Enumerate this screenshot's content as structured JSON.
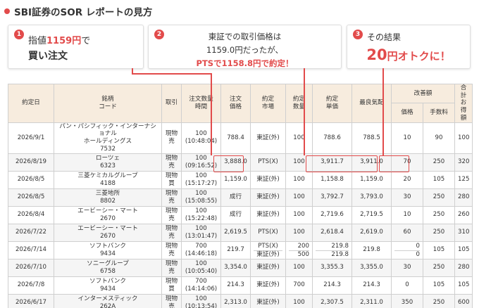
{
  "title": "SBI証券のSOR レポートの見方",
  "callouts": [
    {
      "num": "1",
      "pre": "指値",
      "red": "1159円",
      "post": "で",
      "line2": "買い注文"
    },
    {
      "num": "2",
      "line1": "東証での取引価格は",
      "line2": "1159.0円だったが、",
      "line3": "PTSで1158.8円で約定！"
    },
    {
      "num": "3",
      "line1": "その結果",
      "big": "20",
      "rest": "円オトクに！"
    }
  ],
  "table": {
    "headers": {
      "date": "約定日",
      "name": "銘柄\nコード",
      "type": "取引",
      "qty_time": "注文数量\n時間",
      "order_price": "注文\n価格",
      "market": "約定\n市場",
      "exec_qty": "約定\n数量",
      "exec_price": "約定\n単価",
      "best_quote": "最良気配",
      "improve": "改善額",
      "improve_price": "価格",
      "improve_fee": "手数料",
      "total": "合計\nお得額"
    },
    "rows": [
      {
        "date": "2026/9/1",
        "name": "パン・パシフィック・インターナショナル\nホールディングス",
        "code": "7532",
        "type": "現物\n売",
        "qty": "100",
        "time": "(10:48:04)",
        "order_price": "788.4",
        "markets": [
          "東証(外)"
        ],
        "exec_qtys": [
          "100"
        ],
        "exec_prices": [
          "788.6"
        ],
        "best": "788.5",
        "imp_prices": [
          "10"
        ],
        "fee": "90",
        "total": "100"
      },
      {
        "date": "2026/8/19",
        "name": "ローツェ",
        "code": "6323",
        "type": "現物\n売",
        "qty": "100",
        "time": "(09:16:52)",
        "order_price": "3,888.0",
        "markets": [
          "PTS(X)"
        ],
        "exec_qtys": [
          "100"
        ],
        "exec_prices": [
          "3,911.7"
        ],
        "best": "3,911.0",
        "imp_prices": [
          "70"
        ],
        "fee": "250",
        "total": "320"
      },
      {
        "date": "2026/8/5",
        "name": "三菱ケミカルグループ",
        "code": "4188",
        "type": "現物\n買",
        "qty": "100",
        "time": "(15:17:27)",
        "order_price": "1,159.0",
        "markets": [
          "東証(外)"
        ],
        "exec_qtys": [
          "100"
        ],
        "exec_prices": [
          "1,158.8"
        ],
        "best": "1,159.0",
        "imp_prices": [
          "20"
        ],
        "fee": "105",
        "total": "125"
      },
      {
        "date": "2026/8/5",
        "name": "三菱地所",
        "code": "8802",
        "type": "現物\n売",
        "qty": "100",
        "time": "(15:08:55)",
        "order_price": "成行",
        "markets": [
          "東証(外)"
        ],
        "exec_qtys": [
          "100"
        ],
        "exec_prices": [
          "3,792.7"
        ],
        "best": "3,793.0",
        "imp_prices": [
          "30"
        ],
        "fee": "250",
        "total": "280"
      },
      {
        "date": "2026/8/4",
        "name": "エービーシー・マート",
        "code": "2670",
        "type": "現物\n売",
        "qty": "100",
        "time": "(15:22:48)",
        "order_price": "成行",
        "markets": [
          "東証(外)"
        ],
        "exec_qtys": [
          "100"
        ],
        "exec_prices": [
          "2,719.6"
        ],
        "best": "2,719.5",
        "imp_prices": [
          "10"
        ],
        "fee": "250",
        "total": "260"
      },
      {
        "date": "2026/7/22",
        "name": "エービーシー・マート",
        "code": "2670",
        "type": "現物\n売",
        "qty": "100",
        "time": "(13:01:47)",
        "order_price": "2,619.5",
        "markets": [
          "PTS(X)"
        ],
        "exec_qtys": [
          "100"
        ],
        "exec_prices": [
          "2,618.4"
        ],
        "best": "2,619.0",
        "imp_prices": [
          "60"
        ],
        "fee": "250",
        "total": "310"
      },
      {
        "date": "2026/7/14",
        "name": "ソフトバンク",
        "code": "9434",
        "type": "現物\n売",
        "qty": "700",
        "time": "(14:46:18)",
        "order_price": "219.7",
        "markets": [
          "PTS(X)",
          "東証(外)"
        ],
        "exec_qtys": [
          "200",
          "500"
        ],
        "exec_prices": [
          "219.8",
          "219.8"
        ],
        "best": "219.8",
        "imp_prices": [
          "0",
          "0"
        ],
        "fee": "105",
        "total": "105"
      },
      {
        "date": "2026/7/10",
        "name": "ソニーグループ",
        "code": "6758",
        "type": "現物\n売",
        "qty": "100",
        "time": "(10:05:40)",
        "order_price": "3,354.0",
        "markets": [
          "東証(外)"
        ],
        "exec_qtys": [
          "100"
        ],
        "exec_prices": [
          "3,355.3"
        ],
        "best": "3,355.0",
        "imp_prices": [
          "30"
        ],
        "fee": "250",
        "total": "280"
      },
      {
        "date": "2026/7/8",
        "name": "ソフトバンク",
        "code": "9434",
        "type": "現物\n買",
        "qty": "700",
        "time": "(14:14:06)",
        "order_price": "214.3",
        "markets": [
          "東証(外)"
        ],
        "exec_qtys": [
          "700"
        ],
        "exec_prices": [
          "214.3"
        ],
        "best": "214.3",
        "imp_prices": [
          "0"
        ],
        "fee": "105",
        "total": "105"
      },
      {
        "date": "2026/6/17",
        "name": "インターメスティック",
        "code": "262A",
        "type": "現物\n売",
        "qty": "100",
        "time": "(10:13:54)",
        "order_price": "2,313.0",
        "markets": [
          "東証(外)"
        ],
        "exec_qtys": [
          "100"
        ],
        "exec_prices": [
          "2,307.5"
        ],
        "best": "2,311.0",
        "imp_prices": [
          "350"
        ],
        "fee": "250",
        "total": "600"
      }
    ]
  },
  "colors": {
    "accent": "#e24b4b",
    "header_bg": "#f7ecde",
    "border": "#cfcfcf"
  }
}
